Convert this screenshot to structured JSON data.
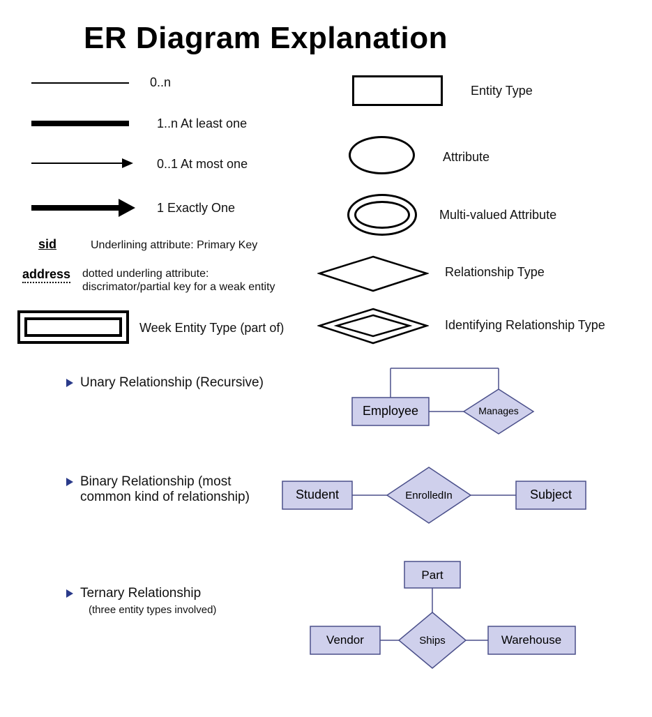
{
  "title": "ER Diagram Explanation",
  "cardinality": {
    "zero_n": "0..n",
    "one_n": "1..n At least one",
    "zero_one": "0..1 At most one",
    "one": "1 Exactly One"
  },
  "key_notation": {
    "sid_label": "sid",
    "sid_desc": "Underlining attribute: Primary Key",
    "address_label": "address",
    "address_desc_line1": "dotted underling attribute:",
    "address_desc_line2": "discrimator/partial key for a weak entity"
  },
  "weak_entity_label": "Week Entity Type (part of)",
  "right_legend": {
    "entity_type": "Entity Type",
    "attribute": "Attribute",
    "multi_valued": "Multi-valued Attribute",
    "relationship": "Relationship Type",
    "identifying_relationship": "Identifying Relationship Type"
  },
  "relationships": {
    "unary": {
      "title": "Unary Relationship (Recursive)",
      "entity": "Employee",
      "rel": "Manages"
    },
    "binary": {
      "title_line1": "Binary Relationship (most",
      "title_line2": "common kind of relationship)",
      "entity_left": "Student",
      "rel": "EnrolledIn",
      "entity_right": "Subject"
    },
    "ternary": {
      "title": "Ternary Relationship",
      "subtitle": "(three entity types involved)",
      "entity_top": "Part",
      "entity_left": "Vendor",
      "rel": "Ships",
      "entity_right": "Warehouse"
    }
  },
  "colors": {
    "entity_fill": "#cfd0ec",
    "entity_stroke": "#4a4f8a",
    "bullet": "#2a3a8a"
  }
}
